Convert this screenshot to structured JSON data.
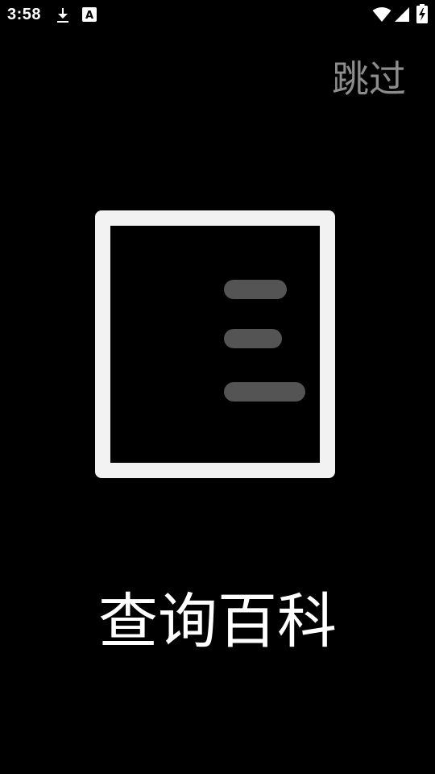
{
  "status_bar": {
    "time": "3:58",
    "notification_icons": [
      "download-icon",
      "a-badge-icon"
    ],
    "system_icons": [
      "wifi-icon",
      "signal-icon",
      "battery-charging-icon"
    ],
    "a_badge_text": "A"
  },
  "splash": {
    "skip_label": "跳过",
    "title": "查询百科",
    "logo_icon": "document-list-icon"
  },
  "colors": {
    "background": "#000000",
    "skip_text": "#8c8c8c",
    "logo_frame": "#f2f2f2",
    "logo_lines": "#545454",
    "title_text": "#ffffff"
  }
}
